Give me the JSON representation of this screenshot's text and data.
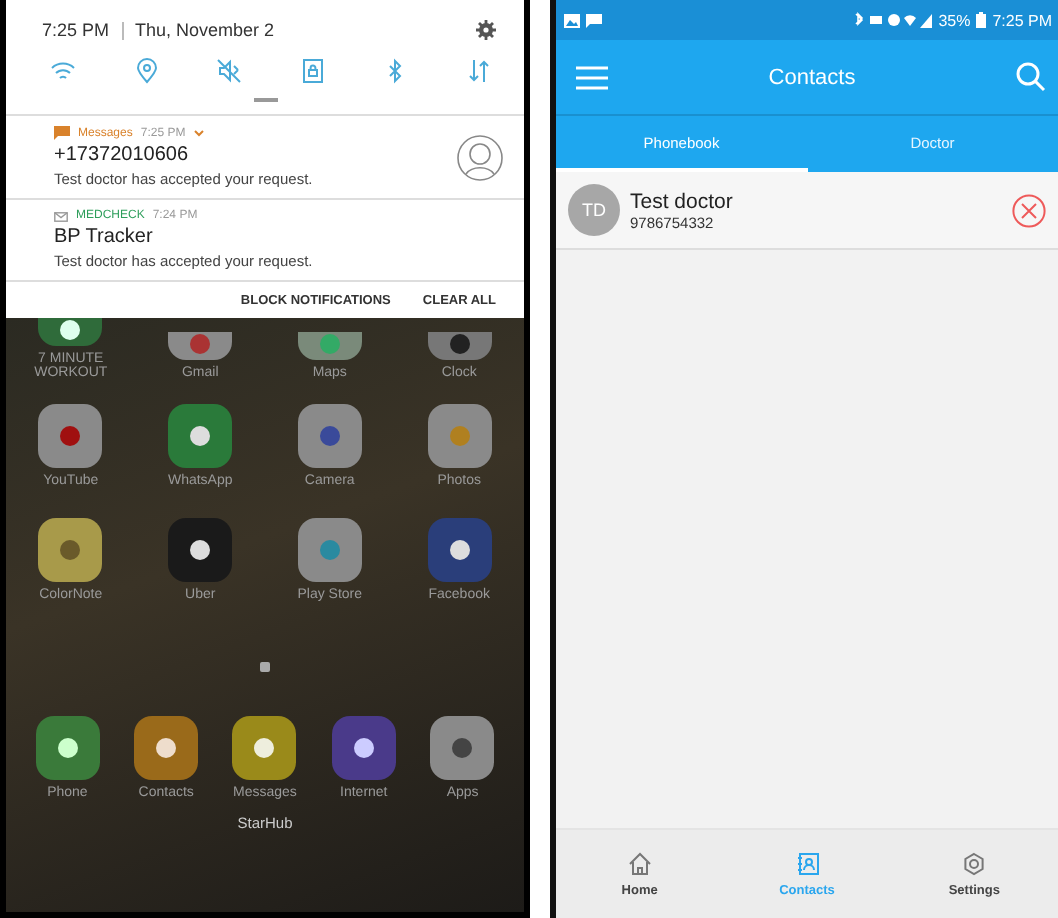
{
  "notification_shade": {
    "time": "7:25 PM",
    "date": "Thu, November 2",
    "notifications": [
      {
        "kind": "message",
        "app": "Messages",
        "color": "#d9822b",
        "time": "7:25 PM",
        "title": "+17372010606",
        "text": "Test doctor has accepted your request."
      },
      {
        "kind": "app",
        "app": "MEDCHECK",
        "color": "#2e9e5b",
        "time": "7:24 PM",
        "title": "BP Tracker",
        "text": "Test doctor has accepted your request."
      }
    ],
    "actions": [
      "BLOCK NOTIFICATIONS",
      "CLEAR ALL"
    ]
  },
  "home_screen": {
    "top_row": [
      {
        "kind": "workout",
        "label": "7 MINUTE WORKOUT"
      },
      {
        "kind": "mail",
        "label": "Gmail"
      },
      {
        "kind": "maps",
        "label": "Maps"
      },
      {
        "kind": "clock",
        "label": "Clock"
      }
    ],
    "rows": [
      [
        {
          "kind": "video",
          "label": "YouTube"
        },
        {
          "kind": "chat",
          "label": "WhatsApp"
        },
        {
          "kind": "camera",
          "label": "Camera"
        },
        {
          "kind": "photos",
          "label": "Photos"
        }
      ],
      [
        {
          "kind": "note",
          "label": "ColorNote"
        },
        {
          "kind": "ride",
          "label": "Uber"
        },
        {
          "kind": "store",
          "label": "Play Store"
        },
        {
          "kind": "social",
          "label": "Facebook"
        }
      ]
    ],
    "dock": [
      {
        "kind": "phone",
        "label": "Phone"
      },
      {
        "kind": "contacts",
        "label": "Contacts"
      },
      {
        "kind": "messages",
        "label": "Messages"
      },
      {
        "kind": "internet",
        "label": "Internet"
      },
      {
        "kind": "apps",
        "label": "Apps"
      }
    ],
    "carrier": "StarHub"
  },
  "contacts_app": {
    "status_bar": {
      "battery": "35%",
      "time": "7:25 PM"
    },
    "title": "Contacts",
    "tabs": [
      {
        "label": "Phonebook",
        "selected": true
      },
      {
        "label": "Doctor",
        "selected": false
      }
    ],
    "contacts": [
      {
        "initials": "TD",
        "name": "Test doctor",
        "phone": "9786754332"
      }
    ],
    "bottom_nav": [
      {
        "kind": "home",
        "label": "Home",
        "selected": false
      },
      {
        "kind": "contacts",
        "label": "Contacts",
        "selected": true
      },
      {
        "kind": "settings",
        "label": "Settings",
        "selected": false
      }
    ]
  }
}
